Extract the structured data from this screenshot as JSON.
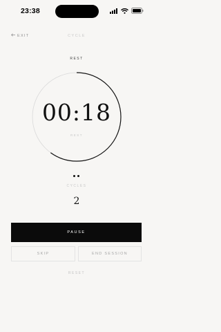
{
  "status_bar": {
    "time": "23:38",
    "icons": [
      "signal-icon",
      "wifi-icon",
      "battery-icon"
    ]
  },
  "header": {
    "exit_label": "EXIT",
    "title": "CYCLE"
  },
  "timer": {
    "phase_label": "REST",
    "time": "00:18",
    "sub_label": "REST",
    "progress": 0.6
  },
  "cycle_dots": 2,
  "cycles": {
    "label": "CYCLES",
    "value": "2"
  },
  "controls": {
    "pause_label": "PAUSE",
    "skip_label": "SKIP",
    "end_session_label": "END SESSION",
    "reset_label": "RESET"
  },
  "colors": {
    "background": "#f7f6f4",
    "primary": "#0b0b0b",
    "muted": "#c8c8c8"
  }
}
